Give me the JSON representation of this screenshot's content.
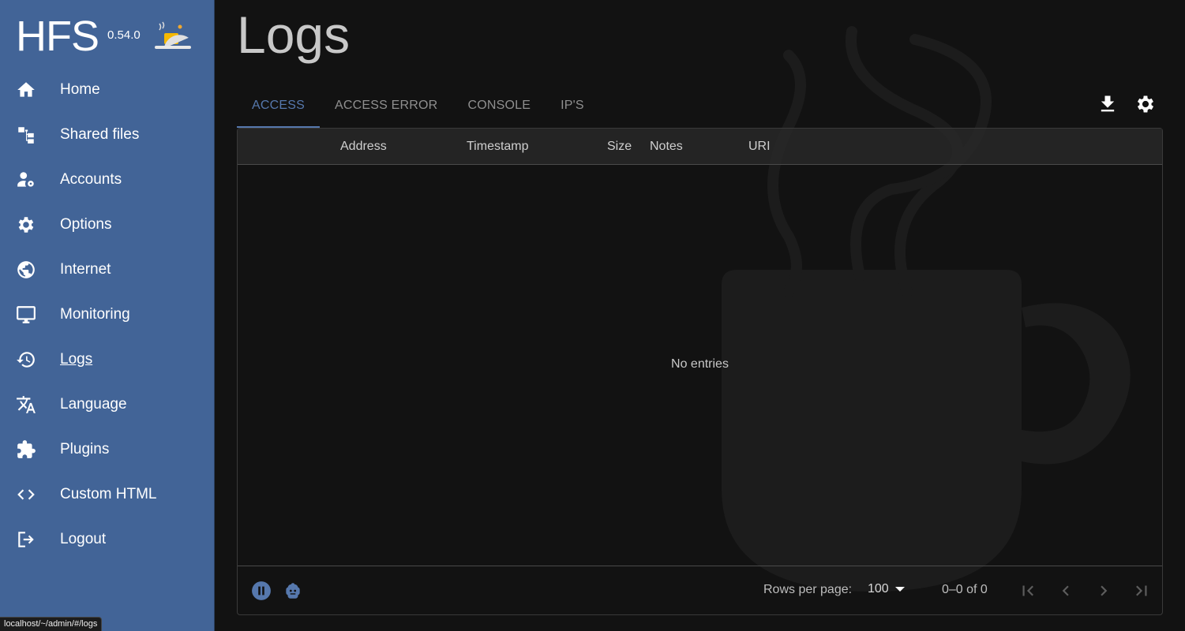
{
  "brand": {
    "name": "HFS",
    "version": "0.54.0",
    "logo_icon": "cloche-icon"
  },
  "sidebar": {
    "items": [
      {
        "label": "Home",
        "icon": "home-icon"
      },
      {
        "label": "Shared files",
        "icon": "file-tree-icon"
      },
      {
        "label": "Accounts",
        "icon": "manage-accounts-icon"
      },
      {
        "label": "Options",
        "icon": "gear-icon"
      },
      {
        "label": "Internet",
        "icon": "globe-icon"
      },
      {
        "label": "Monitoring",
        "icon": "monitor-icon"
      },
      {
        "label": "Logs",
        "icon": "history-icon",
        "active": true
      },
      {
        "label": "Language",
        "icon": "translate-icon"
      },
      {
        "label": "Plugins",
        "icon": "puzzle-icon"
      },
      {
        "label": "Custom HTML",
        "icon": "code-icon"
      },
      {
        "label": "Logout",
        "icon": "logout-icon"
      }
    ]
  },
  "status_bar": {
    "url": "localhost/~/admin/#/logs"
  },
  "main": {
    "title": "Logs",
    "tabs": [
      {
        "label": "ACCESS",
        "active": true
      },
      {
        "label": "ACCESS ERROR"
      },
      {
        "label": "CONSOLE"
      },
      {
        "label": "IP'S"
      }
    ],
    "toolbar": {
      "download_icon": "download-icon",
      "settings_icon": "gear-icon"
    },
    "grid": {
      "columns": [
        "Address",
        "Timestamp",
        "Size",
        "Notes",
        "URI"
      ],
      "empty_message": "No entries",
      "footer": {
        "pause_icon": "pause-icon",
        "bot_icon": "robot-icon",
        "rows_per_page_label": "Rows per page:",
        "rows_per_page_value": "100",
        "range_text": "0–0 of 0"
      }
    }
  },
  "colors": {
    "sidebar_bg": "#426497",
    "accent": "#5678ad",
    "background": "#121212"
  }
}
